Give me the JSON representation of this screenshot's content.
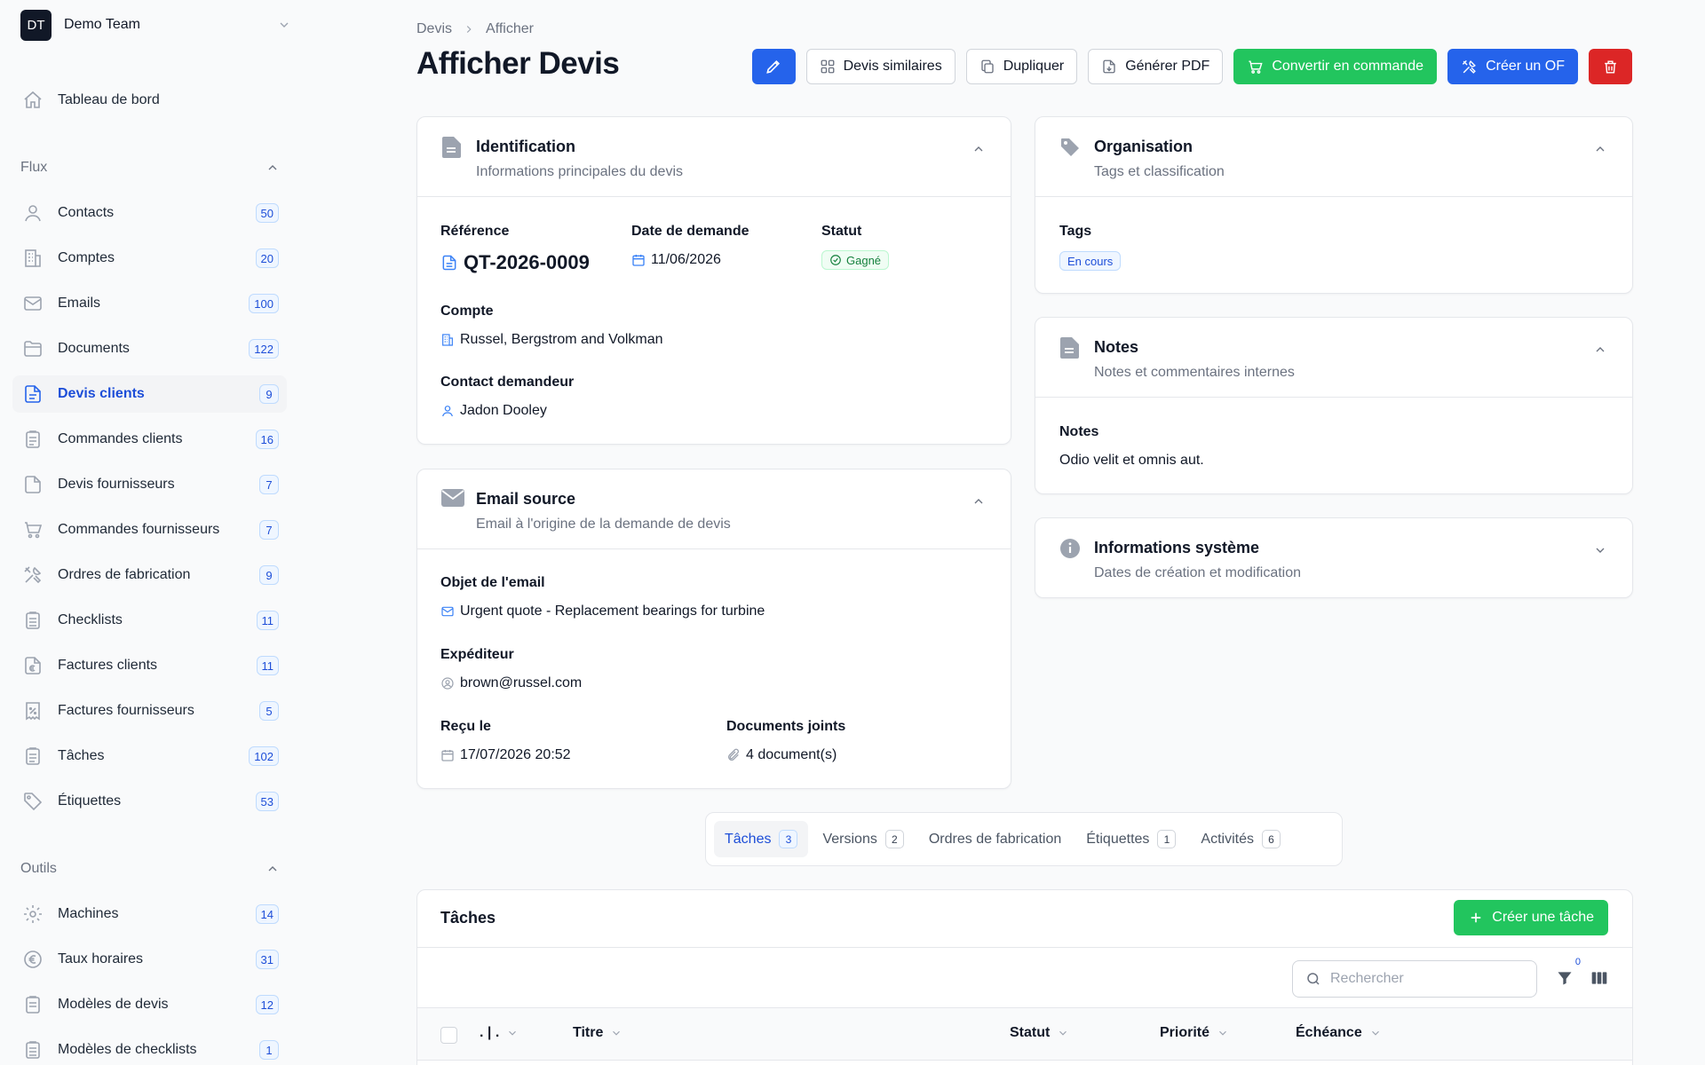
{
  "team": {
    "initials": "DT",
    "name": "Demo Team"
  },
  "nav": {
    "dashboard": "Tableau de bord",
    "flux_title": "Flux",
    "flux": [
      {
        "label": "Contacts",
        "count": "50",
        "icon": "user-icon"
      },
      {
        "label": "Comptes",
        "count": "20",
        "icon": "building-icon"
      },
      {
        "label": "Emails",
        "count": "100",
        "icon": "mail-icon"
      },
      {
        "label": "Documents",
        "count": "122",
        "icon": "folder-icon"
      },
      {
        "label": "Devis clients",
        "count": "9",
        "icon": "document-text-icon",
        "active": true
      },
      {
        "label": "Commandes clients",
        "count": "16",
        "icon": "clipboard-icon"
      },
      {
        "label": "Devis fournisseurs",
        "count": "7",
        "icon": "document-icon"
      },
      {
        "label": "Commandes fournisseurs",
        "count": "7",
        "icon": "cart-icon"
      },
      {
        "label": "Ordres de fabrication",
        "count": "9",
        "icon": "tools-icon"
      },
      {
        "label": "Checklists",
        "count": "11",
        "icon": "checklist-icon"
      },
      {
        "label": "Factures clients",
        "count": "11",
        "icon": "invoice-euro-icon"
      },
      {
        "label": "Factures fournisseurs",
        "count": "5",
        "icon": "receipt-percent-icon"
      },
      {
        "label": "Tâches",
        "count": "102",
        "icon": "tasks-icon"
      },
      {
        "label": "Étiquettes",
        "count": "53",
        "icon": "tag-icon"
      }
    ],
    "tools_title": "Outils",
    "tools": [
      {
        "label": "Machines",
        "count": "14",
        "icon": "cog-icon"
      },
      {
        "label": "Taux horaires",
        "count": "31",
        "icon": "euro-icon"
      },
      {
        "label": "Modèles de devis",
        "count": "12",
        "icon": "template-icon"
      },
      {
        "label": "Modèles de checklists",
        "count": "1",
        "icon": "checklist-template-icon"
      }
    ]
  },
  "breadcrumb": {
    "parent": "Devis",
    "current": "Afficher"
  },
  "page_title": "Afficher Devis",
  "actions": {
    "similar": "Devis similaires",
    "duplicate": "Dupliquer",
    "pdf": "Générer PDF",
    "convert": "Convertir en commande",
    "create_of": "Créer un OF"
  },
  "identification": {
    "title": "Identification",
    "subtitle": "Informations principales du devis",
    "ref_label": "Référence",
    "ref_value": "QT-2026-0009",
    "date_label": "Date de demande",
    "date_value": "11/06/2026",
    "status_label": "Statut",
    "status_value": "Gagné",
    "account_label": "Compte",
    "account_value": "Russel, Bergstrom and Volkman",
    "contact_label": "Contact demandeur",
    "contact_value": "Jadon Dooley"
  },
  "email_source": {
    "title": "Email source",
    "subtitle": "Email à l'origine de la demande de devis",
    "subject_label": "Objet de l'email",
    "subject_value": "Urgent quote - Replacement bearings for turbine",
    "sender_label": "Expéditeur",
    "sender_value": "brown@russel.com",
    "received_label": "Reçu le",
    "received_value": "17/07/2026 20:52",
    "attachments_label": "Documents joints",
    "attachments_value": "4 document(s)"
  },
  "organisation": {
    "title": "Organisation",
    "subtitle": "Tags et classification",
    "tags_label": "Tags",
    "tag": "En cours"
  },
  "notes": {
    "title": "Notes",
    "subtitle": "Notes et commentaires internes",
    "label": "Notes",
    "value": "Odio velit et omnis aut."
  },
  "system": {
    "title": "Informations système",
    "subtitle": "Dates de création et modification"
  },
  "tabs": [
    {
      "label": "Tâches",
      "count": "3",
      "active": true
    },
    {
      "label": "Versions",
      "count": "2"
    },
    {
      "label": "Ordres de fabrication",
      "count": ""
    },
    {
      "label": "Étiquettes",
      "count": "1"
    },
    {
      "label": "Activités",
      "count": "6"
    }
  ],
  "tasks": {
    "title": "Tâches",
    "create": "Créer une tâche",
    "search_placeholder": "Rechercher",
    "filter_count": "0",
    "columns": {
      "drag": ". | .",
      "title": "Titre",
      "status": "Statut",
      "priority": "Priorité",
      "due": "Échéance"
    }
  },
  "colors": {
    "primary": "#2563eb",
    "success": "#22c55e",
    "danger": "#dc2626"
  }
}
